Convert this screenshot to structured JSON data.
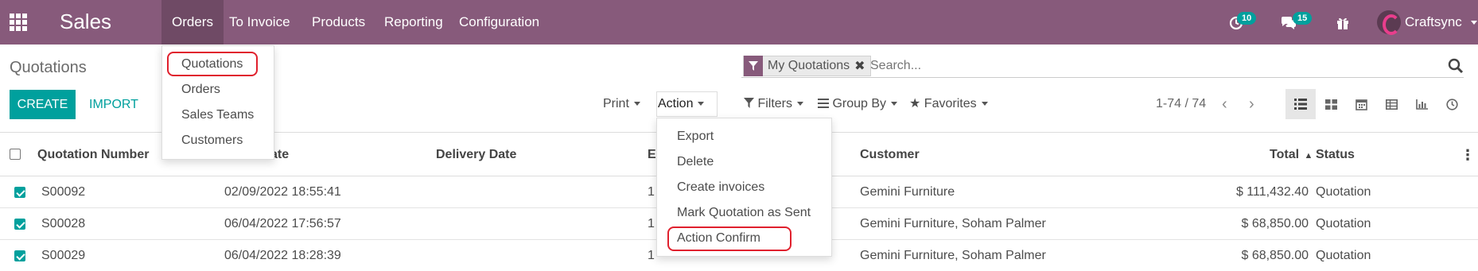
{
  "navbar": {
    "app_name": "Sales",
    "menu": [
      "Orders",
      "To Invoice",
      "Products",
      "Reporting",
      "Configuration"
    ],
    "activity_count": "10",
    "message_count": "15",
    "user_name": "Craftsync",
    "color": "#875a7b"
  },
  "orders_menu": {
    "items": [
      "Quotations",
      "Orders",
      "Sales Teams",
      "Customers"
    ],
    "highlighted": "Quotations"
  },
  "page": {
    "title": "Quotations",
    "create_label": "CREATE",
    "import_label": "IMPORT",
    "print_label": "Print",
    "action_label": "Action",
    "filters_label": "Filters",
    "group_by_label": "Group By",
    "favorites_label": "Favorites",
    "accent": "#00a09d"
  },
  "search": {
    "facet": "My Quotations",
    "placeholder": "Search..."
  },
  "pager": {
    "value": "1-74 / 74"
  },
  "views": [
    "list-view-icon",
    "kanban-view-icon",
    "calendar-view-icon",
    "pivot-view-icon",
    "graph-view-icon",
    "activity-view-icon"
  ],
  "action_menu": {
    "items": [
      "Export",
      "Delete",
      "Create invoices",
      "Mark Quotation as Sent",
      "Action Confirm"
    ],
    "highlighted": "Action Confirm"
  },
  "table": {
    "columns": {
      "number": "Quotation Number",
      "date": "ate",
      "delivery": "Delivery Date",
      "expected": "E",
      "customer": "Customer",
      "total": "Total",
      "status": "Status"
    },
    "rows": [
      {
        "number": "S00092",
        "date": "02/09/2022 18:55:41",
        "expected": "1",
        "customer": "Gemini Furniture",
        "total": "$ 111,432.40",
        "status": "Quotation",
        "checked": true
      },
      {
        "number": "S00028",
        "date": "06/04/2022 17:56:57",
        "expected": "1",
        "customer": "Gemini Furniture, Soham Palmer",
        "total": "$ 68,850.00",
        "status": "Quotation",
        "checked": true
      },
      {
        "number": "S00029",
        "date": "06/04/2022 18:28:39",
        "expected": "1",
        "customer": "Gemini Furniture, Soham Palmer",
        "total": "$ 68,850.00",
        "status": "Quotation",
        "checked": true
      }
    ]
  }
}
